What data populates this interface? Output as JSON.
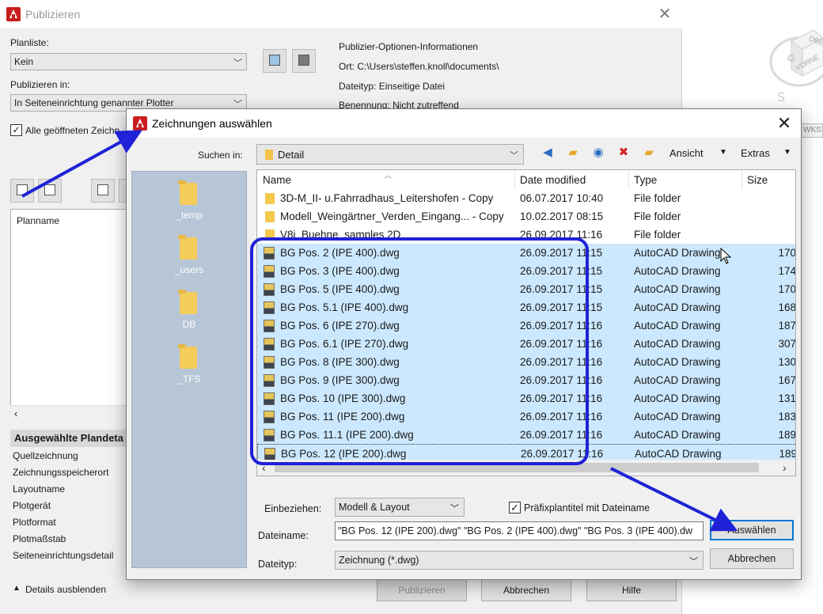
{
  "publizieren": {
    "title": "Publizieren",
    "close_glyph": "✕",
    "planliste_label": "Planliste:",
    "planliste_value": "Kein",
    "publizieren_in_label": "Publizieren in:",
    "publizieren_in_value": "In Seiteneinrichtung genannter Plotter",
    "alle_checkbox_label": "Alle geöffneten Zeichn",
    "info_heading": "Publizier-Optionen-Informationen",
    "info_ort": "Ort:   C:\\Users\\steffen.knoll\\documents\\",
    "info_dateityp": "Dateityp:  Einseitige Datei",
    "info_benennung": "Benennung:  Nicht zutreffend",
    "list_header": "Planname",
    "details_heading": "Ausgewählte Plandeta",
    "details_rows": [
      "Quellzeichnung",
      "Zeichnungsspeicherort",
      "Layoutname",
      "Plotgerät",
      "Plotformat",
      "Plotmaßstab",
      "Seiteneinrichtungsdetail"
    ],
    "details_toggle": "Details ausblenden",
    "btn_publizieren": "Publizieren",
    "btn_abbrechen": "Abbrechen",
    "btn_hilfe": "Hilfe"
  },
  "viewcube": {
    "face_labels": [
      "OBE",
      "VORNE"
    ],
    "wcs_label": "WKS"
  },
  "dialog": {
    "title": "Zeichnungen auswählen",
    "close_glyph": "✕",
    "suchen_in_label": "Suchen in:",
    "suchen_in_value": "Detail",
    "toolbar": {
      "ansicht": "Ansicht",
      "extras": "Extras"
    },
    "places": [
      {
        "label": "_temp"
      },
      {
        "label": "_users"
      },
      {
        "label": "DB"
      },
      {
        "label": "_TFS"
      }
    ],
    "columns": [
      "Name",
      "Date modified",
      "Type",
      "Size"
    ],
    "rows": [
      {
        "name": "3D-M_II- u.Fahrradhaus_Leitershofen - Copy",
        "date": "06.07.2017 10:40",
        "type": "File folder",
        "size": "",
        "kind": "folder",
        "selected": false
      },
      {
        "name": "Modell_Weingärtner_Verden_Eingang... - Copy",
        "date": "10.02.2017 08:15",
        "type": "File folder",
        "size": "",
        "kind": "folder",
        "selected": false
      },
      {
        "name": "V8i_Buehne_samples 2D",
        "date": "26.09.2017 11:16",
        "type": "File folder",
        "size": "",
        "kind": "folder",
        "selected": false
      },
      {
        "name": "BG Pos. 2 (IPE 400).dwg",
        "date": "26.09.2017 11:15",
        "type": "AutoCAD Drawing",
        "size": "170",
        "kind": "dwg",
        "selected": true
      },
      {
        "name": "BG Pos. 3 (IPE 400).dwg",
        "date": "26.09.2017 11:15",
        "type": "AutoCAD Drawing",
        "size": "174",
        "kind": "dwg",
        "selected": true
      },
      {
        "name": "BG Pos. 5 (IPE 400).dwg",
        "date": "26.09.2017 11:15",
        "type": "AutoCAD Drawing",
        "size": "170",
        "kind": "dwg",
        "selected": true
      },
      {
        "name": "BG Pos. 5.1 (IPE 400).dwg",
        "date": "26.09.2017 11:15",
        "type": "AutoCAD Drawing",
        "size": "168",
        "kind": "dwg",
        "selected": true
      },
      {
        "name": "BG Pos. 6 (IPE 270).dwg",
        "date": "26.09.2017 11:16",
        "type": "AutoCAD Drawing",
        "size": "187",
        "kind": "dwg",
        "selected": true
      },
      {
        "name": "BG Pos. 6.1 (IPE 270).dwg",
        "date": "26.09.2017 11:16",
        "type": "AutoCAD Drawing",
        "size": "307",
        "kind": "dwg",
        "selected": true
      },
      {
        "name": "BG Pos. 8 (IPE 300).dwg",
        "date": "26.09.2017 11:16",
        "type": "AutoCAD Drawing",
        "size": "130",
        "kind": "dwg",
        "selected": true
      },
      {
        "name": "BG Pos. 9 (IPE 300).dwg",
        "date": "26.09.2017 11:16",
        "type": "AutoCAD Drawing",
        "size": "167",
        "kind": "dwg",
        "selected": true
      },
      {
        "name": "BG Pos. 10 (IPE 300).dwg",
        "date": "26.09.2017 11:16",
        "type": "AutoCAD Drawing",
        "size": "131",
        "kind": "dwg",
        "selected": true
      },
      {
        "name": "BG Pos. 11 (IPE 200).dwg",
        "date": "26.09.2017 11:16",
        "type": "AutoCAD Drawing",
        "size": "183",
        "kind": "dwg",
        "selected": true
      },
      {
        "name": "BG Pos. 11.1 (IPE 200).dwg",
        "date": "26.09.2017 11:16",
        "type": "AutoCAD Drawing",
        "size": "189",
        "kind": "dwg",
        "selected": true
      },
      {
        "name": "BG Pos. 12 (IPE 200).dwg",
        "date": "26.09.2017 11:16",
        "type": "AutoCAD Drawing",
        "size": "189",
        "kind": "dwg",
        "selected": true,
        "focused": true
      }
    ],
    "einbeziehen_label": "Einbeziehen:",
    "einbeziehen_value": "Modell & Layout",
    "praefix_label": "Präfixplantitel mit Dateiname",
    "praefix_checked": true,
    "dateiname_label": "Dateiname:",
    "dateiname_value": "\"BG Pos. 12 (IPE 200).dwg\" \"BG Pos. 2 (IPE 400).dwg\" \"BG Pos. 3 (IPE 400).dw",
    "dateityp_label": "Dateityp:",
    "dateityp_value": "Zeichnung (*.dwg)",
    "btn_auswaehlen": "Auswählen",
    "btn_abbrechen": "Abbrechen"
  },
  "annotation_color": "#1f22d6",
  "selection_color": "#cce8ff"
}
